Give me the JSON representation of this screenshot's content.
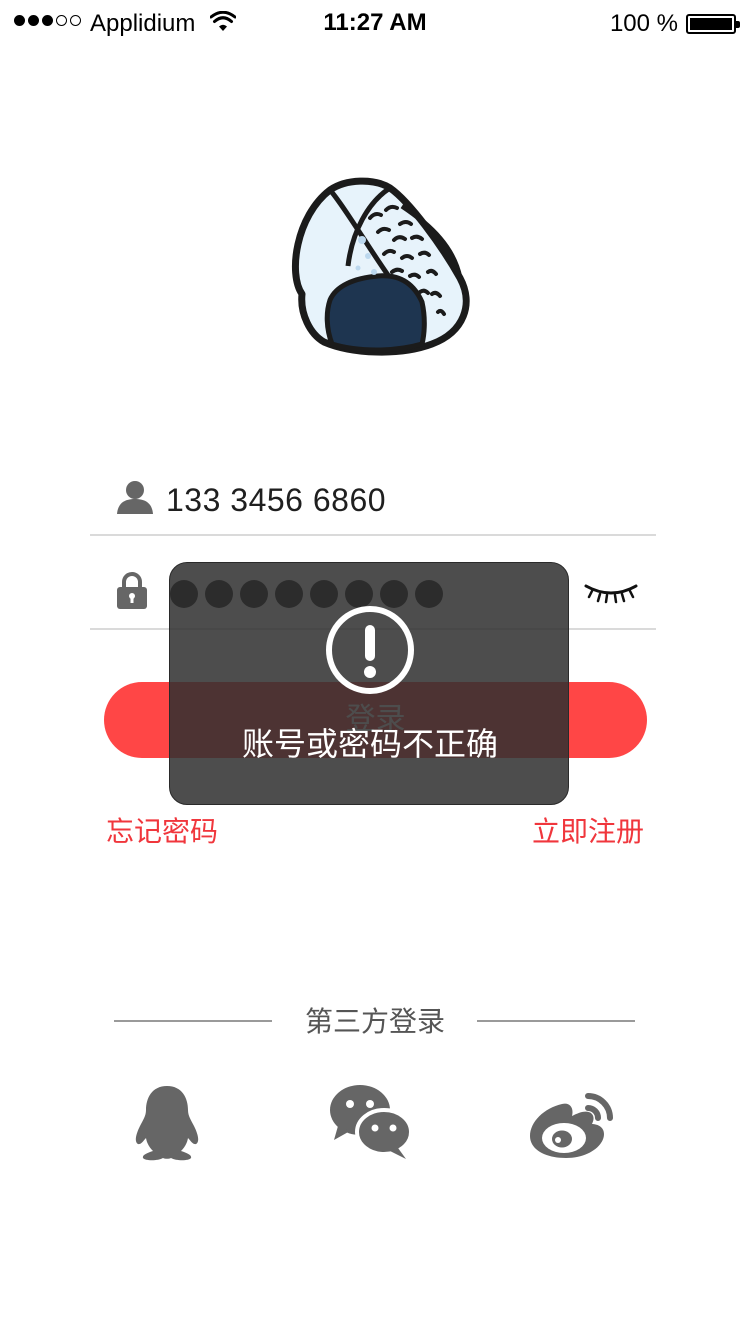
{
  "status_bar": {
    "carrier": "Applidium",
    "time": "11:27 AM",
    "battery": "100 %",
    "signal_bars": 3,
    "signal_max": 5
  },
  "logo": {
    "icon": "rice-ball-logo"
  },
  "form": {
    "phone": "133 3456 6860",
    "user_icon": "user-icon",
    "lock_icon": "lock-icon",
    "password_dots": 8,
    "visibility_icon": "eye-closed-icon"
  },
  "actions": {
    "login_label": "登录",
    "forgot_label": "忘记密码",
    "register_label": "立即注册"
  },
  "third_party": {
    "title": "第三方登录",
    "providers": [
      {
        "icon": "qq-icon"
      },
      {
        "icon": "wechat-icon"
      },
      {
        "icon": "weibo-icon"
      }
    ]
  },
  "toast": {
    "icon": "alert-icon",
    "message": "账号或密码不正确"
  },
  "colors": {
    "accent": "#ff4646",
    "link": "#f0363c",
    "icon_gray": "#666666",
    "divider": "#dadada",
    "toast_bg": "#303030"
  }
}
